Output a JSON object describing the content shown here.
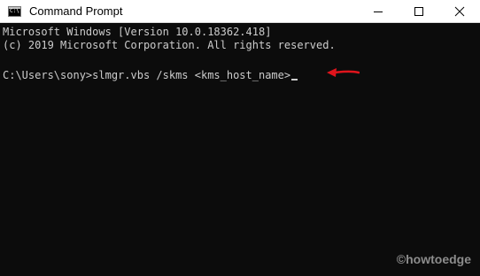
{
  "window": {
    "title": "Command Prompt",
    "icon": "cmd-icon",
    "controls": [
      "minimize-icon",
      "maximize-icon",
      "close-icon"
    ]
  },
  "console": {
    "lines": [
      "Microsoft Windows [Version 10.0.18362.418]",
      "(c) 2019 Microsoft Corporation. All rights reserved.",
      "C:\\Users\\sony>slmgr.vbs /skms <kms_host_name>"
    ],
    "colors": {
      "background": "#0c0c0c",
      "text": "#cccccc",
      "annotation_arrow": "#e0141c"
    }
  },
  "annotation": {
    "icon": "red-arrow-icon"
  },
  "watermark": "©howtoedge"
}
